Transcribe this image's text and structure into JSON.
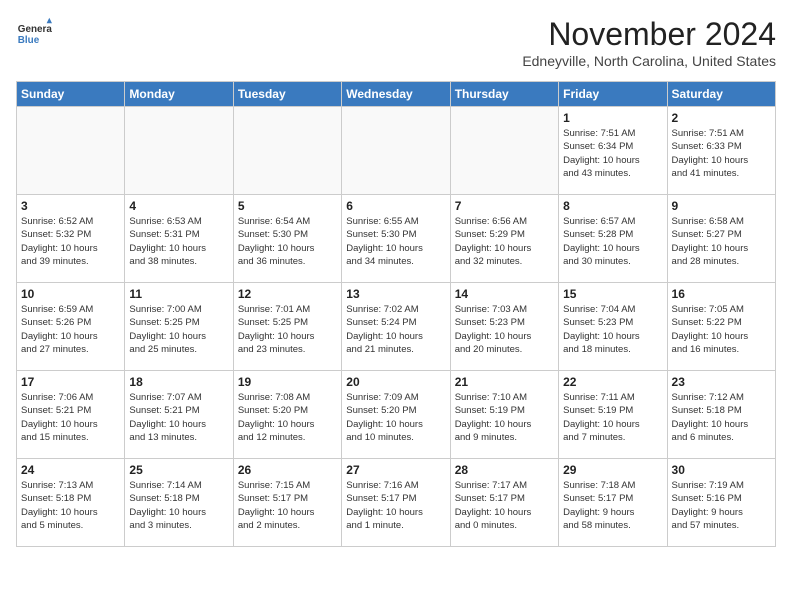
{
  "header": {
    "logo_line1": "General",
    "logo_line2": "Blue",
    "month": "November 2024",
    "location": "Edneyville, North Carolina, United States"
  },
  "days_of_week": [
    "Sunday",
    "Monday",
    "Tuesday",
    "Wednesday",
    "Thursday",
    "Friday",
    "Saturday"
  ],
  "weeks": [
    [
      {
        "day": "",
        "info": ""
      },
      {
        "day": "",
        "info": ""
      },
      {
        "day": "",
        "info": ""
      },
      {
        "day": "",
        "info": ""
      },
      {
        "day": "",
        "info": ""
      },
      {
        "day": "1",
        "info": "Sunrise: 7:51 AM\nSunset: 6:34 PM\nDaylight: 10 hours\nand 43 minutes."
      },
      {
        "day": "2",
        "info": "Sunrise: 7:51 AM\nSunset: 6:33 PM\nDaylight: 10 hours\nand 41 minutes."
      }
    ],
    [
      {
        "day": "3",
        "info": "Sunrise: 6:52 AM\nSunset: 5:32 PM\nDaylight: 10 hours\nand 39 minutes."
      },
      {
        "day": "4",
        "info": "Sunrise: 6:53 AM\nSunset: 5:31 PM\nDaylight: 10 hours\nand 38 minutes."
      },
      {
        "day": "5",
        "info": "Sunrise: 6:54 AM\nSunset: 5:30 PM\nDaylight: 10 hours\nand 36 minutes."
      },
      {
        "day": "6",
        "info": "Sunrise: 6:55 AM\nSunset: 5:30 PM\nDaylight: 10 hours\nand 34 minutes."
      },
      {
        "day": "7",
        "info": "Sunrise: 6:56 AM\nSunset: 5:29 PM\nDaylight: 10 hours\nand 32 minutes."
      },
      {
        "day": "8",
        "info": "Sunrise: 6:57 AM\nSunset: 5:28 PM\nDaylight: 10 hours\nand 30 minutes."
      },
      {
        "day": "9",
        "info": "Sunrise: 6:58 AM\nSunset: 5:27 PM\nDaylight: 10 hours\nand 28 minutes."
      }
    ],
    [
      {
        "day": "10",
        "info": "Sunrise: 6:59 AM\nSunset: 5:26 PM\nDaylight: 10 hours\nand 27 minutes."
      },
      {
        "day": "11",
        "info": "Sunrise: 7:00 AM\nSunset: 5:25 PM\nDaylight: 10 hours\nand 25 minutes."
      },
      {
        "day": "12",
        "info": "Sunrise: 7:01 AM\nSunset: 5:25 PM\nDaylight: 10 hours\nand 23 minutes."
      },
      {
        "day": "13",
        "info": "Sunrise: 7:02 AM\nSunset: 5:24 PM\nDaylight: 10 hours\nand 21 minutes."
      },
      {
        "day": "14",
        "info": "Sunrise: 7:03 AM\nSunset: 5:23 PM\nDaylight: 10 hours\nand 20 minutes."
      },
      {
        "day": "15",
        "info": "Sunrise: 7:04 AM\nSunset: 5:23 PM\nDaylight: 10 hours\nand 18 minutes."
      },
      {
        "day": "16",
        "info": "Sunrise: 7:05 AM\nSunset: 5:22 PM\nDaylight: 10 hours\nand 16 minutes."
      }
    ],
    [
      {
        "day": "17",
        "info": "Sunrise: 7:06 AM\nSunset: 5:21 PM\nDaylight: 10 hours\nand 15 minutes."
      },
      {
        "day": "18",
        "info": "Sunrise: 7:07 AM\nSunset: 5:21 PM\nDaylight: 10 hours\nand 13 minutes."
      },
      {
        "day": "19",
        "info": "Sunrise: 7:08 AM\nSunset: 5:20 PM\nDaylight: 10 hours\nand 12 minutes."
      },
      {
        "day": "20",
        "info": "Sunrise: 7:09 AM\nSunset: 5:20 PM\nDaylight: 10 hours\nand 10 minutes."
      },
      {
        "day": "21",
        "info": "Sunrise: 7:10 AM\nSunset: 5:19 PM\nDaylight: 10 hours\nand 9 minutes."
      },
      {
        "day": "22",
        "info": "Sunrise: 7:11 AM\nSunset: 5:19 PM\nDaylight: 10 hours\nand 7 minutes."
      },
      {
        "day": "23",
        "info": "Sunrise: 7:12 AM\nSunset: 5:18 PM\nDaylight: 10 hours\nand 6 minutes."
      }
    ],
    [
      {
        "day": "24",
        "info": "Sunrise: 7:13 AM\nSunset: 5:18 PM\nDaylight: 10 hours\nand 5 minutes."
      },
      {
        "day": "25",
        "info": "Sunrise: 7:14 AM\nSunset: 5:18 PM\nDaylight: 10 hours\nand 3 minutes."
      },
      {
        "day": "26",
        "info": "Sunrise: 7:15 AM\nSunset: 5:17 PM\nDaylight: 10 hours\nand 2 minutes."
      },
      {
        "day": "27",
        "info": "Sunrise: 7:16 AM\nSunset: 5:17 PM\nDaylight: 10 hours\nand 1 minute."
      },
      {
        "day": "28",
        "info": "Sunrise: 7:17 AM\nSunset: 5:17 PM\nDaylight: 10 hours\nand 0 minutes."
      },
      {
        "day": "29",
        "info": "Sunrise: 7:18 AM\nSunset: 5:17 PM\nDaylight: 9 hours\nand 58 minutes."
      },
      {
        "day": "30",
        "info": "Sunrise: 7:19 AM\nSunset: 5:16 PM\nDaylight: 9 hours\nand 57 minutes."
      }
    ]
  ]
}
